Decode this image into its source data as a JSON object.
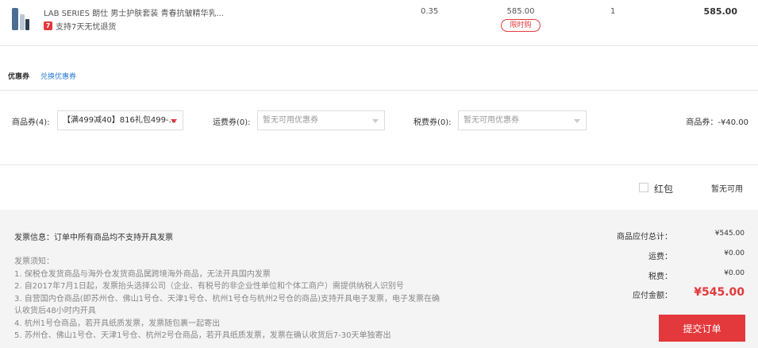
{
  "product": {
    "name": "LAB SERIES 朗仕 男士护肤套装 青春抗皱精华乳...",
    "return_badge": "7",
    "return_text": "支持7天无忧退货",
    "weight": "0.35",
    "price": "585.00",
    "flash_tag": "限时购",
    "quantity": "1",
    "subtotal": "585.00"
  },
  "coupons": {
    "title": "优惠券",
    "exchange_link": "兑换优惠券",
    "goods_label": "商品券(4):",
    "goods_selected": "【满499减40】816礼包499-...",
    "shipping_label": "运费券(0):",
    "shipping_placeholder": "暂无可用优惠券",
    "tax_label": "税费券(0):",
    "tax_placeholder": "暂无可用优惠券",
    "goods_discount": "商品券：-¥40.00"
  },
  "red_packet": {
    "label": "红包",
    "status": "暂无可用"
  },
  "invoice": {
    "title": "发票信息：订单中所有商品均不支持开具发票",
    "notes": [
      "发票须知：",
      "1. 保税仓发货商品与海外仓发货商品属跨境海外商品，无法开具国内发票",
      "2. 自2017年7月1日起，发票抬头选择公司（企业、有税号的非企业性单位和个体工商户）需提供纳税人识别号",
      "3. 自营国内仓商品(即苏州仓、佛山1号仓、天津1号仓、杭州1号仓与杭州2号仓的商品)支持开具电子发票，电子发票在确",
      "认收货后48小时内开具",
      "4. 杭州1号仓商品，若开具纸质发票，发票随包裹一起寄出",
      "5. 苏州仓、佛山1号仓、天津1号仓、杭州2号仓商品，若开具纸质发票，发票在确认收货后7-30天单独寄出"
    ]
  },
  "summary": {
    "goods_total_label": "商品应付总计：",
    "goods_total_value": "¥545.00",
    "shipping_label": "运费：",
    "shipping_value": "¥0.00",
    "tax_label": "税费：",
    "tax_value": "¥0.00",
    "payable_label": "应付金额：",
    "payable_value": "¥545.00",
    "submit_label": "提交订单"
  },
  "colors": {
    "accent": "#e4393c",
    "link": "#2b7cd3"
  }
}
